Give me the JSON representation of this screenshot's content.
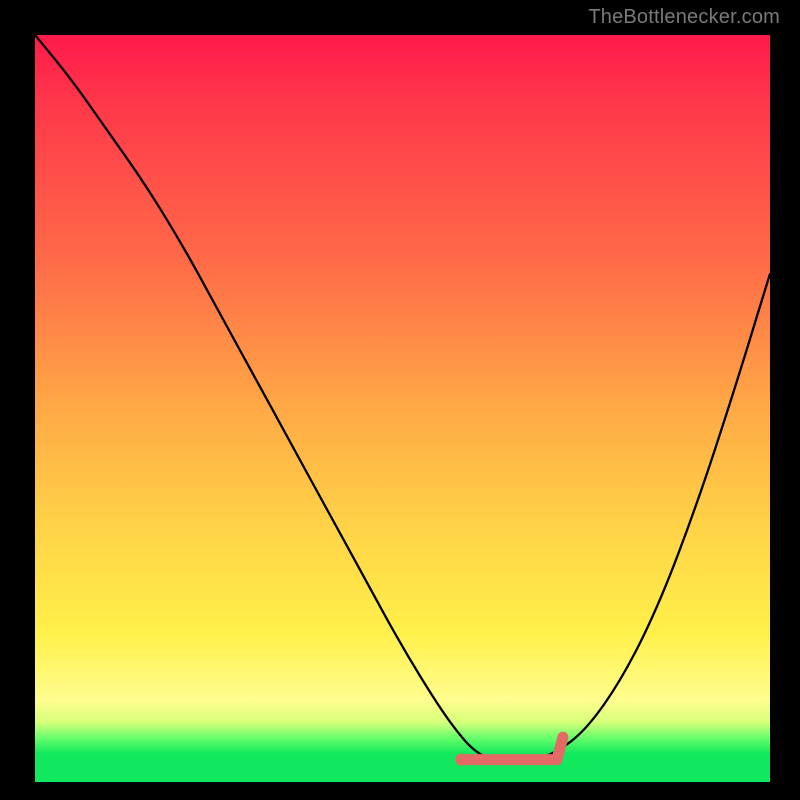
{
  "watermark": "TheBottlenecker.com",
  "chart_data": {
    "type": "line",
    "title": "",
    "xlabel": "",
    "ylabel": "",
    "xlim": [
      0,
      100
    ],
    "ylim": [
      0,
      100
    ],
    "x": [
      0,
      5,
      10,
      15,
      20,
      25,
      30,
      35,
      40,
      45,
      50,
      55,
      58,
      60,
      62,
      65,
      68,
      71,
      75,
      80,
      85,
      90,
      95,
      100
    ],
    "y": [
      100,
      94,
      87,
      80,
      72,
      63,
      54,
      45,
      36,
      27,
      18,
      10,
      6,
      4,
      3,
      3,
      3,
      4,
      7,
      14,
      24,
      37,
      52,
      68
    ],
    "minimum_marker": {
      "x_start": 58,
      "x_end": 71,
      "y": 3
    },
    "right_stub": {
      "x": 71,
      "y_bottom": 3,
      "y_top": 6
    },
    "colors": {
      "gradient_top": "#ff1a4b",
      "gradient_mid1": "#ffa946",
      "gradient_mid2": "#fff04a",
      "gradient_bottom_band": "#12e85d",
      "curve": "#000000",
      "marker": "#e46a66",
      "background_frame": "#000000"
    },
    "annotations": []
  }
}
